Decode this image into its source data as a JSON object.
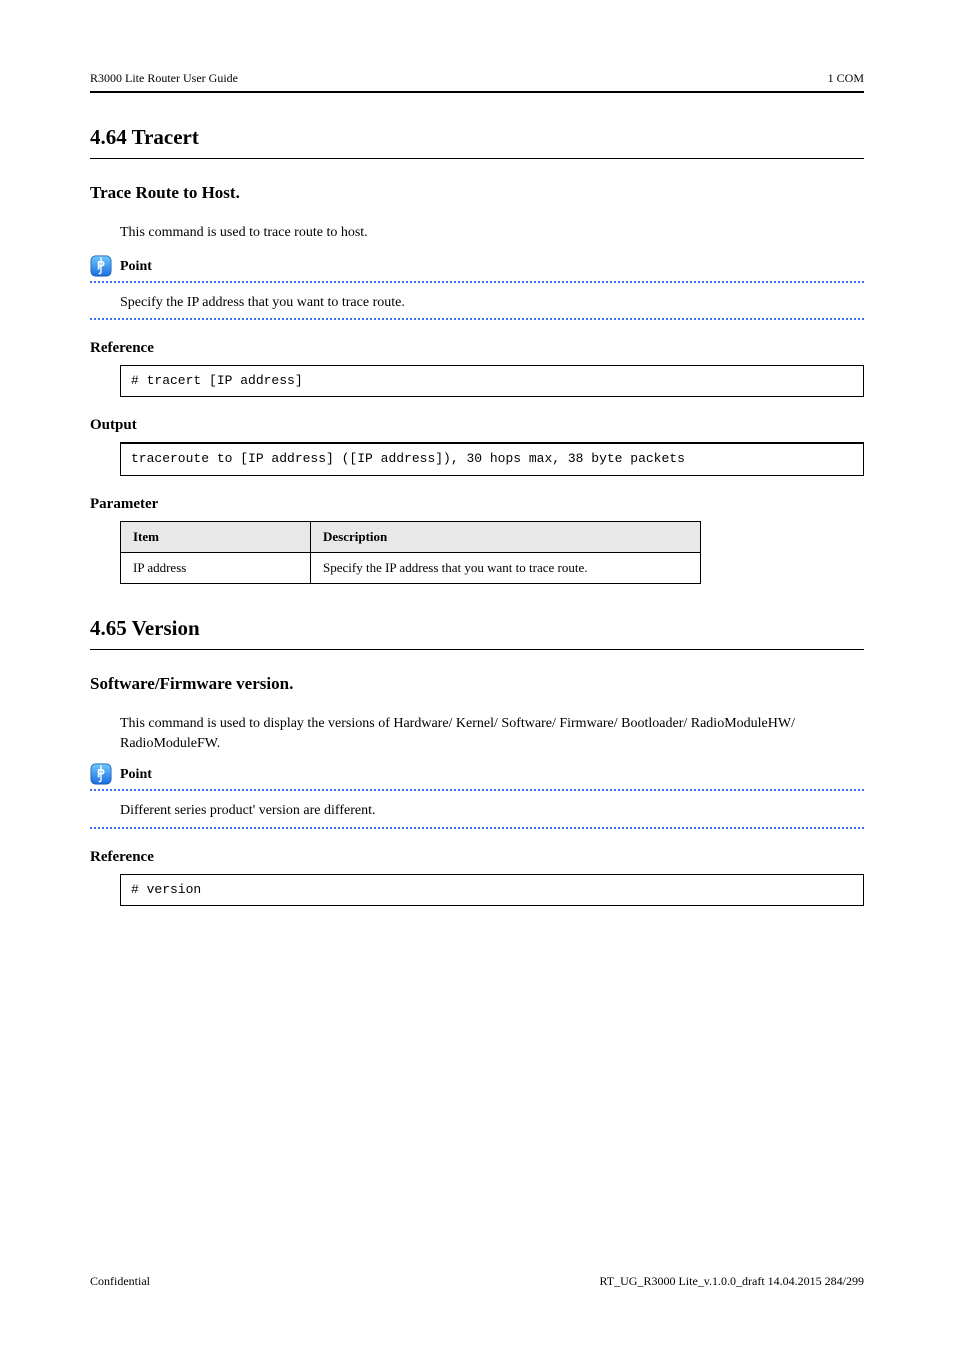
{
  "header": {
    "left": "R3000 Lite Router User Guide",
    "right": "1 COM"
  },
  "section1": {
    "title": "4.64 Tracert",
    "subhead": "Trace Route to Host.",
    "intro": "This command is used to trace route to host.",
    "tip": {
      "label": "Point",
      "text": "Specify the IP address that you want to trace route."
    },
    "ref_label": "Reference",
    "code": "# tracert [IP address]",
    "output_label": "Output",
    "output": "traceroute to [IP address] ([IP address]), 30 hops max, 38 byte packets",
    "param_label": "Parameter",
    "table": {
      "headers": [
        "Item",
        "Description"
      ],
      "rows": [
        [
          "IP address",
          "Specify the IP address that you want to trace route."
        ]
      ]
    }
  },
  "section2": {
    "title": "4.65 Version",
    "subhead": "Software/Firmware version.",
    "intro": "This command is used to display the versions of Hardware/ Kernel/ Software/ Firmware/ Bootloader/ RadioModuleHW/ RadioModuleFW.",
    "tip": {
      "label": "Point",
      "text": "Different series product' version are different."
    },
    "ref_label": "Reference",
    "code": "# version"
  },
  "footer": {
    "left": "Confidential",
    "right": "RT_UG_R3000 Lite_v.1.0.0_draft  14.04.2015 284/299"
  },
  "icon": "P"
}
